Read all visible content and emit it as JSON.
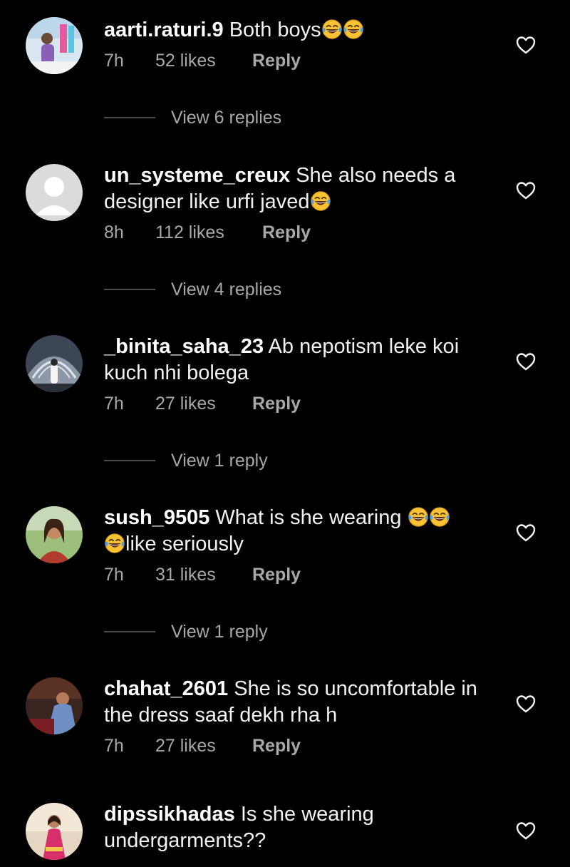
{
  "comments": [
    {
      "username": "aarti.raturi.9",
      "text": "Both boys",
      "emoji_after": 2,
      "time": "7h",
      "likes": "52 likes",
      "reply": "Reply",
      "view_replies": "View 6 replies"
    },
    {
      "username": "un_systeme_creux",
      "text": "She also needs a designer like urfi javed",
      "emoji_after": 1,
      "time": "8h",
      "likes": "112 likes",
      "reply": "Reply",
      "view_replies": "View 4 replies"
    },
    {
      "username": "_binita_saha_23",
      "text": "Ab nepotism leke koi kuch nhi bolega",
      "time": "7h",
      "likes": "27 likes",
      "reply": "Reply",
      "view_replies": "View 1 reply"
    },
    {
      "username": "sush_9505",
      "text_before": "What is she wearing",
      "text_after": "like seriously",
      "time": "7h",
      "likes": "31 likes",
      "reply": "Reply",
      "view_replies": "View 1 reply"
    },
    {
      "username": "chahat_2601",
      "text": "She is so uncomfortable in the dress saaf dekh rha h",
      "time": "7h",
      "likes": "27 likes",
      "reply": "Reply"
    },
    {
      "username": "dipssikhadas",
      "text": "Is she wearing undergarments??"
    }
  ],
  "icons": {
    "like": "heart-outline-icon",
    "emoji": "face-with-tears-of-joy-icon"
  },
  "colors": {
    "background": "#000000",
    "meta_text": "#a8a8a8",
    "emoji_yellow": "#f7c233",
    "emoji_tears": "#4aa3e8"
  }
}
